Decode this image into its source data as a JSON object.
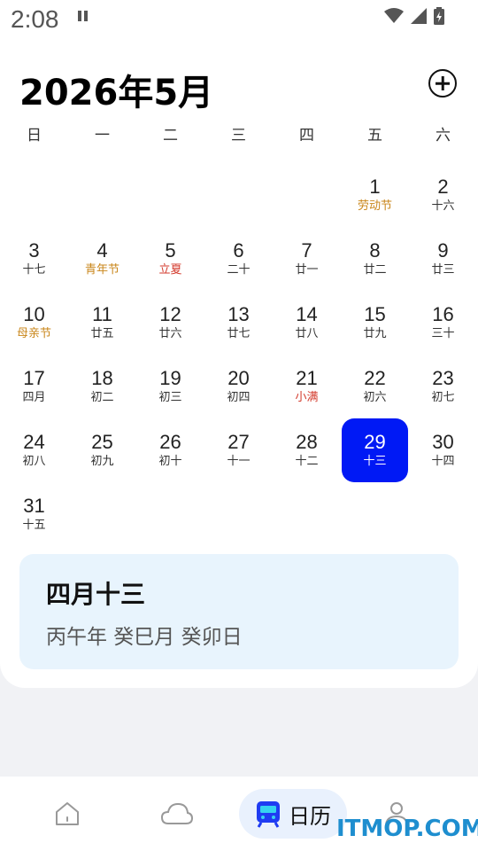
{
  "status_bar": {
    "time": "2:08"
  },
  "calendar": {
    "month_title": "2026年5月",
    "weekdays": [
      "日",
      "一",
      "二",
      "三",
      "四",
      "五",
      "六"
    ],
    "leading_blanks": 5,
    "days": [
      {
        "num": "1",
        "sub": "劳动节",
        "type": "festival"
      },
      {
        "num": "2",
        "sub": "十六",
        "type": "lunar"
      },
      {
        "num": "3",
        "sub": "十七",
        "type": "lunar"
      },
      {
        "num": "4",
        "sub": "青年节",
        "type": "festival"
      },
      {
        "num": "5",
        "sub": "立夏",
        "type": "term"
      },
      {
        "num": "6",
        "sub": "二十",
        "type": "lunar"
      },
      {
        "num": "7",
        "sub": "廿一",
        "type": "lunar"
      },
      {
        "num": "8",
        "sub": "廿二",
        "type": "lunar"
      },
      {
        "num": "9",
        "sub": "廿三",
        "type": "lunar"
      },
      {
        "num": "10",
        "sub": "母亲节",
        "type": "festival"
      },
      {
        "num": "11",
        "sub": "廿五",
        "type": "lunar"
      },
      {
        "num": "12",
        "sub": "廿六",
        "type": "lunar"
      },
      {
        "num": "13",
        "sub": "廿七",
        "type": "lunar"
      },
      {
        "num": "14",
        "sub": "廿八",
        "type": "lunar"
      },
      {
        "num": "15",
        "sub": "廿九",
        "type": "lunar"
      },
      {
        "num": "16",
        "sub": "三十",
        "type": "lunar"
      },
      {
        "num": "17",
        "sub": "四月",
        "type": "lunar"
      },
      {
        "num": "18",
        "sub": "初二",
        "type": "lunar"
      },
      {
        "num": "19",
        "sub": "初三",
        "type": "lunar"
      },
      {
        "num": "20",
        "sub": "初四",
        "type": "lunar"
      },
      {
        "num": "21",
        "sub": "小满",
        "type": "term"
      },
      {
        "num": "22",
        "sub": "初六",
        "type": "lunar"
      },
      {
        "num": "23",
        "sub": "初七",
        "type": "lunar"
      },
      {
        "num": "24",
        "sub": "初八",
        "type": "lunar"
      },
      {
        "num": "25",
        "sub": "初九",
        "type": "lunar"
      },
      {
        "num": "26",
        "sub": "初十",
        "type": "lunar"
      },
      {
        "num": "27",
        "sub": "十一",
        "type": "lunar"
      },
      {
        "num": "28",
        "sub": "十二",
        "type": "lunar"
      },
      {
        "num": "29",
        "sub": "十三",
        "type": "lunar",
        "selected": true
      },
      {
        "num": "30",
        "sub": "十四",
        "type": "lunar"
      },
      {
        "num": "31",
        "sub": "十五",
        "type": "lunar"
      }
    ]
  },
  "info_card": {
    "lunar_date": "四月十三",
    "ganzhi": "丙午年 癸巳月 癸卯日"
  },
  "bottom_nav": {
    "calendar_label": "日历"
  },
  "watermark": "ITMOP.COM",
  "colors": {
    "selected_bg": "#0019f5",
    "festival": "#c9861a",
    "solar_term": "#d33a2c",
    "info_card_bg": "#e8f4fd",
    "nav_active_bg": "#e9f1fd"
  },
  "icons": {
    "signal": "wifi-icon",
    "cellular": "cellular-icon",
    "battery": "battery-icon",
    "add": "plus-circle-icon",
    "home": "home-icon",
    "weather": "cloud-icon",
    "calendar": "calendar-app-icon",
    "profile": "person-icon"
  }
}
